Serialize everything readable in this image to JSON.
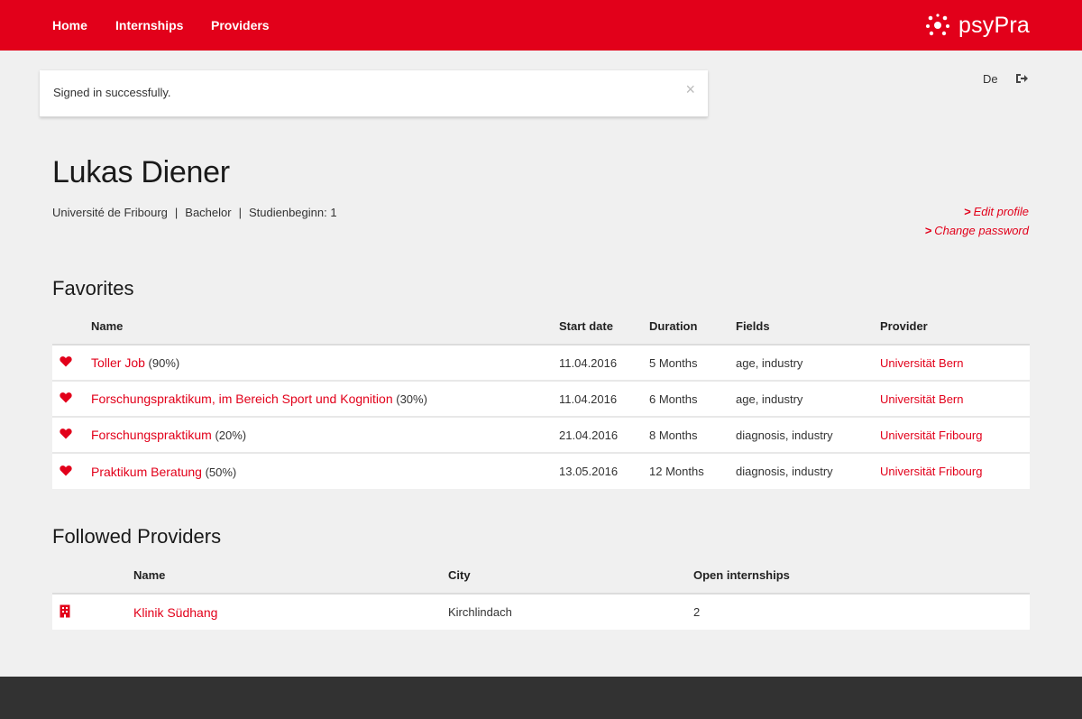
{
  "nav": {
    "items": [
      {
        "label": "Home"
      },
      {
        "label": "Internships"
      },
      {
        "label": "Providers"
      }
    ],
    "logo_text": "psyPra",
    "brand_color": "#e2001a"
  },
  "alert": {
    "message": "Signed in successfully.",
    "close_glyph": "×"
  },
  "utility": {
    "language": "De",
    "signout_icon": "sign-out-icon"
  },
  "profile": {
    "name": "Lukas Diener",
    "university": "Université de Fribourg",
    "degree": "Bachelor",
    "study_start": "Studienbeginn: 1",
    "separator": "|",
    "edit_profile": "Edit profile",
    "change_password": "Change password",
    "link_chevron": ">"
  },
  "favorites": {
    "title": "Favorites",
    "columns": [
      "Name",
      "Start date",
      "Duration",
      "Fields",
      "Provider"
    ],
    "rows": [
      {
        "title": "Toller Job",
        "match": "(90%)",
        "start": "11.04.2016",
        "duration": "5 Months",
        "fields": "age, industry",
        "provider": "Universität Bern"
      },
      {
        "title": "Forschungspraktikum, im Bereich Sport und Kognition",
        "match": "(30%)",
        "start": "11.04.2016",
        "duration": "6 Months",
        "fields": "age, industry",
        "provider": "Universität Bern"
      },
      {
        "title": "Forschungspraktikum",
        "match": "(20%)",
        "start": "21.04.2016",
        "duration": "8 Months",
        "fields": "diagnosis, industry",
        "provider": "Universität Fribourg"
      },
      {
        "title": "Praktikum Beratung",
        "match": "(50%)",
        "start": "13.05.2016",
        "duration": "12 Months",
        "fields": "diagnosis, industry",
        "provider": "Universität Fribourg"
      }
    ],
    "row_icon": "heart-icon"
  },
  "followed_providers": {
    "title": "Followed Providers",
    "columns": [
      "Name",
      "City",
      "Open internships"
    ],
    "rows": [
      {
        "name": "Klinik Südhang",
        "city": "Kirchlindach",
        "open": "2"
      }
    ],
    "row_icon": "building-icon"
  }
}
